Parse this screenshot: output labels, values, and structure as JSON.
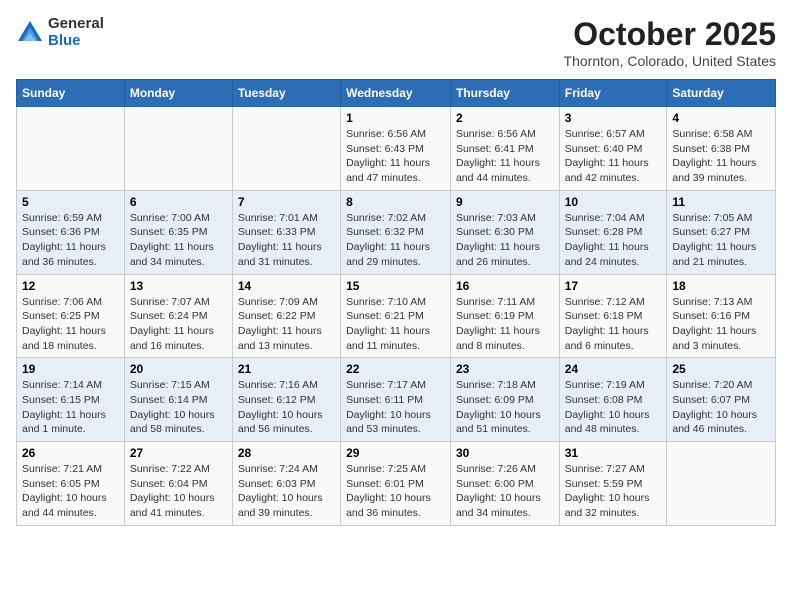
{
  "logo": {
    "general": "General",
    "blue": "Blue"
  },
  "title": "October 2025",
  "subtitle": "Thornton, Colorado, United States",
  "days_of_week": [
    "Sunday",
    "Monday",
    "Tuesday",
    "Wednesday",
    "Thursday",
    "Friday",
    "Saturday"
  ],
  "weeks": [
    [
      {
        "num": "",
        "info": ""
      },
      {
        "num": "",
        "info": ""
      },
      {
        "num": "",
        "info": ""
      },
      {
        "num": "1",
        "info": "Sunrise: 6:56 AM\nSunset: 6:43 PM\nDaylight: 11 hours and 47 minutes."
      },
      {
        "num": "2",
        "info": "Sunrise: 6:56 AM\nSunset: 6:41 PM\nDaylight: 11 hours and 44 minutes."
      },
      {
        "num": "3",
        "info": "Sunrise: 6:57 AM\nSunset: 6:40 PM\nDaylight: 11 hours and 42 minutes."
      },
      {
        "num": "4",
        "info": "Sunrise: 6:58 AM\nSunset: 6:38 PM\nDaylight: 11 hours and 39 minutes."
      }
    ],
    [
      {
        "num": "5",
        "info": "Sunrise: 6:59 AM\nSunset: 6:36 PM\nDaylight: 11 hours and 36 minutes."
      },
      {
        "num": "6",
        "info": "Sunrise: 7:00 AM\nSunset: 6:35 PM\nDaylight: 11 hours and 34 minutes."
      },
      {
        "num": "7",
        "info": "Sunrise: 7:01 AM\nSunset: 6:33 PM\nDaylight: 11 hours and 31 minutes."
      },
      {
        "num": "8",
        "info": "Sunrise: 7:02 AM\nSunset: 6:32 PM\nDaylight: 11 hours and 29 minutes."
      },
      {
        "num": "9",
        "info": "Sunrise: 7:03 AM\nSunset: 6:30 PM\nDaylight: 11 hours and 26 minutes."
      },
      {
        "num": "10",
        "info": "Sunrise: 7:04 AM\nSunset: 6:28 PM\nDaylight: 11 hours and 24 minutes."
      },
      {
        "num": "11",
        "info": "Sunrise: 7:05 AM\nSunset: 6:27 PM\nDaylight: 11 hours and 21 minutes."
      }
    ],
    [
      {
        "num": "12",
        "info": "Sunrise: 7:06 AM\nSunset: 6:25 PM\nDaylight: 11 hours and 18 minutes."
      },
      {
        "num": "13",
        "info": "Sunrise: 7:07 AM\nSunset: 6:24 PM\nDaylight: 11 hours and 16 minutes."
      },
      {
        "num": "14",
        "info": "Sunrise: 7:09 AM\nSunset: 6:22 PM\nDaylight: 11 hours and 13 minutes."
      },
      {
        "num": "15",
        "info": "Sunrise: 7:10 AM\nSunset: 6:21 PM\nDaylight: 11 hours and 11 minutes."
      },
      {
        "num": "16",
        "info": "Sunrise: 7:11 AM\nSunset: 6:19 PM\nDaylight: 11 hours and 8 minutes."
      },
      {
        "num": "17",
        "info": "Sunrise: 7:12 AM\nSunset: 6:18 PM\nDaylight: 11 hours and 6 minutes."
      },
      {
        "num": "18",
        "info": "Sunrise: 7:13 AM\nSunset: 6:16 PM\nDaylight: 11 hours and 3 minutes."
      }
    ],
    [
      {
        "num": "19",
        "info": "Sunrise: 7:14 AM\nSunset: 6:15 PM\nDaylight: 11 hours and 1 minute."
      },
      {
        "num": "20",
        "info": "Sunrise: 7:15 AM\nSunset: 6:14 PM\nDaylight: 10 hours and 58 minutes."
      },
      {
        "num": "21",
        "info": "Sunrise: 7:16 AM\nSunset: 6:12 PM\nDaylight: 10 hours and 56 minutes."
      },
      {
        "num": "22",
        "info": "Sunrise: 7:17 AM\nSunset: 6:11 PM\nDaylight: 10 hours and 53 minutes."
      },
      {
        "num": "23",
        "info": "Sunrise: 7:18 AM\nSunset: 6:09 PM\nDaylight: 10 hours and 51 minutes."
      },
      {
        "num": "24",
        "info": "Sunrise: 7:19 AM\nSunset: 6:08 PM\nDaylight: 10 hours and 48 minutes."
      },
      {
        "num": "25",
        "info": "Sunrise: 7:20 AM\nSunset: 6:07 PM\nDaylight: 10 hours and 46 minutes."
      }
    ],
    [
      {
        "num": "26",
        "info": "Sunrise: 7:21 AM\nSunset: 6:05 PM\nDaylight: 10 hours and 44 minutes."
      },
      {
        "num": "27",
        "info": "Sunrise: 7:22 AM\nSunset: 6:04 PM\nDaylight: 10 hours and 41 minutes."
      },
      {
        "num": "28",
        "info": "Sunrise: 7:24 AM\nSunset: 6:03 PM\nDaylight: 10 hours and 39 minutes."
      },
      {
        "num": "29",
        "info": "Sunrise: 7:25 AM\nSunset: 6:01 PM\nDaylight: 10 hours and 36 minutes."
      },
      {
        "num": "30",
        "info": "Sunrise: 7:26 AM\nSunset: 6:00 PM\nDaylight: 10 hours and 34 minutes."
      },
      {
        "num": "31",
        "info": "Sunrise: 7:27 AM\nSunset: 5:59 PM\nDaylight: 10 hours and 32 minutes."
      },
      {
        "num": "",
        "info": ""
      }
    ]
  ]
}
